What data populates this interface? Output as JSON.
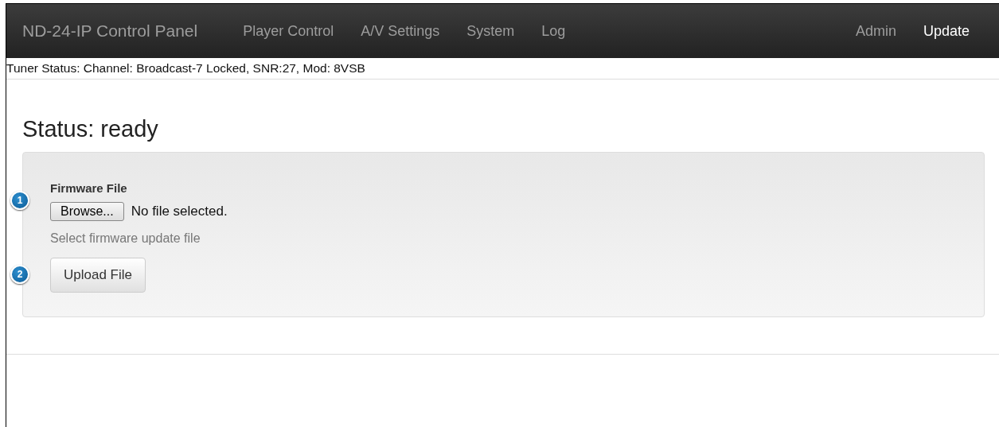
{
  "navbar": {
    "brand": "ND-24-IP Control Panel",
    "left_links": [
      {
        "label": "Player Control",
        "selected": false
      },
      {
        "label": "A/V Settings",
        "selected": false
      },
      {
        "label": "System",
        "selected": false
      },
      {
        "label": "Log",
        "selected": false
      }
    ],
    "right_links": [
      {
        "label": "Admin",
        "selected": false
      },
      {
        "label": "Update",
        "selected": true
      }
    ]
  },
  "tuner_status": "Tuner Status: Channel: Broadcast-7 Locked, SNR:27, Mod: 8VSB",
  "status_heading": "Status: ready",
  "form": {
    "label": "Firmware File",
    "browse_button": "Browse...",
    "file_status": "No file selected.",
    "help": "Select firmware update file",
    "submit_button": "Upload File"
  },
  "callouts": [
    "1",
    "2"
  ]
}
